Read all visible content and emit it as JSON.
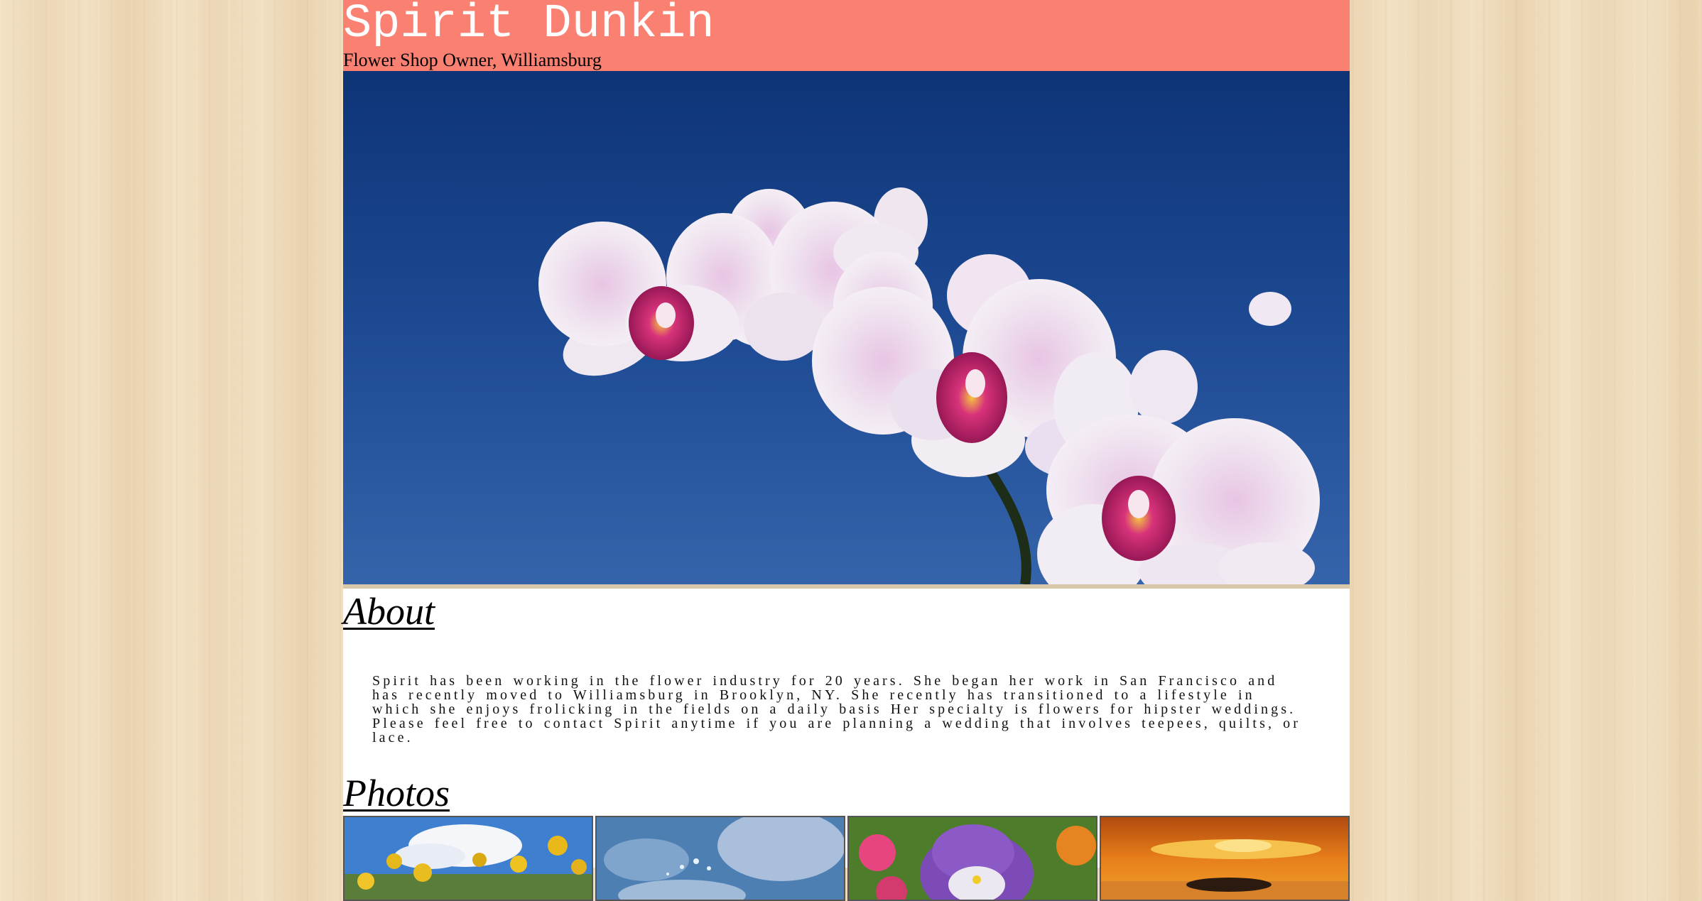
{
  "header": {
    "title": "Spirit Dunkin",
    "subtitle": "Flower Shop Owner, Williamsburg",
    "background_color": "#fa8072"
  },
  "hero": {
    "image": "orchid-photo",
    "sky_color": "#1d4a93"
  },
  "about": {
    "heading": "About",
    "text": "Spirit has been working in the flower industry for 20 years. She began her work in San Francisco and has recently moved to Williamsburg in Brooklyn, NY. She recently has transitioned to a lifestyle in which she enjoys frolicking in the fields on a daily basis Her specialty is flowers for hipster weddings. Please feel free to contact Spirit anytime if you are planning a wedding that involves teepees, quilts, or lace."
  },
  "photos": {
    "heading": "Photos",
    "thumbnails": [
      {
        "image": "yellow-flowers-photo"
      },
      {
        "image": "water-splash-photo"
      },
      {
        "image": "purple-pansy-photo"
      },
      {
        "image": "sunset-photo"
      }
    ]
  }
}
